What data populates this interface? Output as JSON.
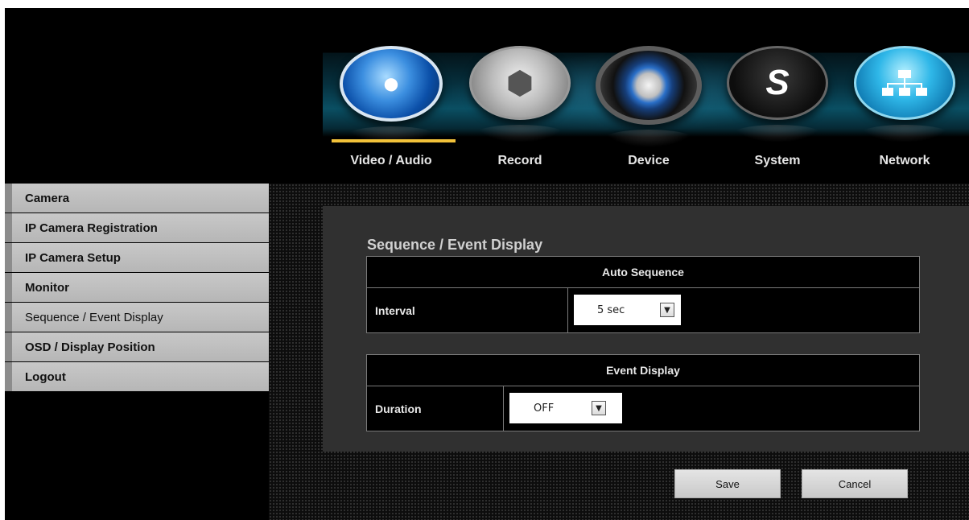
{
  "nav": {
    "items": [
      {
        "id": "video",
        "label": "Video / Audio",
        "icon": "film-reel-icon",
        "active": true
      },
      {
        "id": "record",
        "label": "Record",
        "icon": "camera-aperture-icon",
        "active": false
      },
      {
        "id": "device",
        "label": "Device",
        "icon": "dial-knob-icon",
        "active": false
      },
      {
        "id": "system",
        "label": "System",
        "icon": "s-swirl-icon",
        "active": false
      },
      {
        "id": "network",
        "label": "Network",
        "icon": "network-tree-icon",
        "active": false
      }
    ],
    "active_color": "#f2c23a"
  },
  "sidebar": {
    "items": [
      {
        "label": "Camera"
      },
      {
        "label": "IP Camera Registration"
      },
      {
        "label": "IP Camera Setup"
      },
      {
        "label": "Monitor"
      },
      {
        "label": "Sequence / Event Display",
        "active": true
      },
      {
        "label": "OSD / Display Position"
      },
      {
        "label": "Logout"
      }
    ]
  },
  "main": {
    "title": "Sequence / Event Display",
    "auto_sequence": {
      "header": "Auto Sequence",
      "interval_label": "Interval",
      "interval_value": "5 sec"
    },
    "event_display": {
      "header": "Event Display",
      "duration_label": "Duration",
      "duration_value": "OFF"
    }
  },
  "buttons": {
    "save": "Save",
    "cancel": "Cancel"
  }
}
